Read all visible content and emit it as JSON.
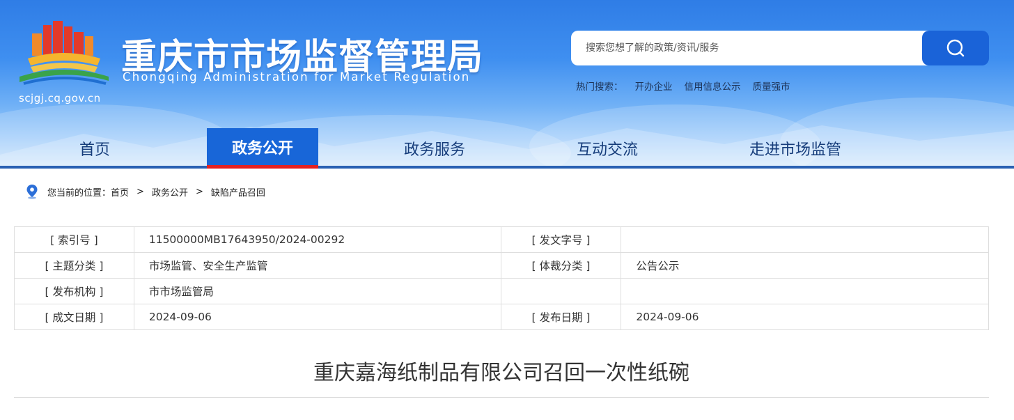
{
  "site": {
    "title": "重庆市市场监督管理局",
    "subtitle": "Chongqing  Administration for Market Regulation",
    "domain": "scjgj.cq.gov.cn"
  },
  "search": {
    "placeholder": "搜索您想了解的政策/资讯/服务",
    "hot_label": "热门搜索：",
    "hot_terms": [
      "开办企业",
      "信用信息公示",
      "质量强市"
    ]
  },
  "nav": {
    "items": [
      "首页",
      "政务公开",
      "政务服务",
      "互动交流",
      "走进市场监管"
    ],
    "active_index": 1
  },
  "breadcrumb": {
    "prefix": "您当前的位置：",
    "items": [
      "首页",
      "政务公开",
      "缺陷产品召回"
    ],
    "separator": ">"
  },
  "meta": {
    "rows": [
      [
        "[ 索引号 ]",
        "11500000MB17643950/2024-00292",
        "[ 发文字号 ]",
        ""
      ],
      [
        "[ 主题分类 ]",
        "市场监管、安全生产监管",
        "[ 体裁分类 ]",
        "公告公示"
      ],
      [
        "[ 发布机构 ]",
        "市市场监管局",
        "",
        ""
      ],
      [
        "[ 成文日期 ]",
        "2024-09-06",
        "[ 发布日期 ]",
        "2024-09-06"
      ]
    ]
  },
  "article": {
    "title": "重庆嘉海纸制品有限公司召回一次性纸碗"
  },
  "icons": {
    "logo": "cqamr-logo",
    "search": "search-icon",
    "location": "location-pin-icon"
  },
  "colors": {
    "header_blue": "#2f7de6",
    "nav_active": "#1866d8",
    "nav_active_underline": "#e42121",
    "search_button": "#1a63d8"
  }
}
